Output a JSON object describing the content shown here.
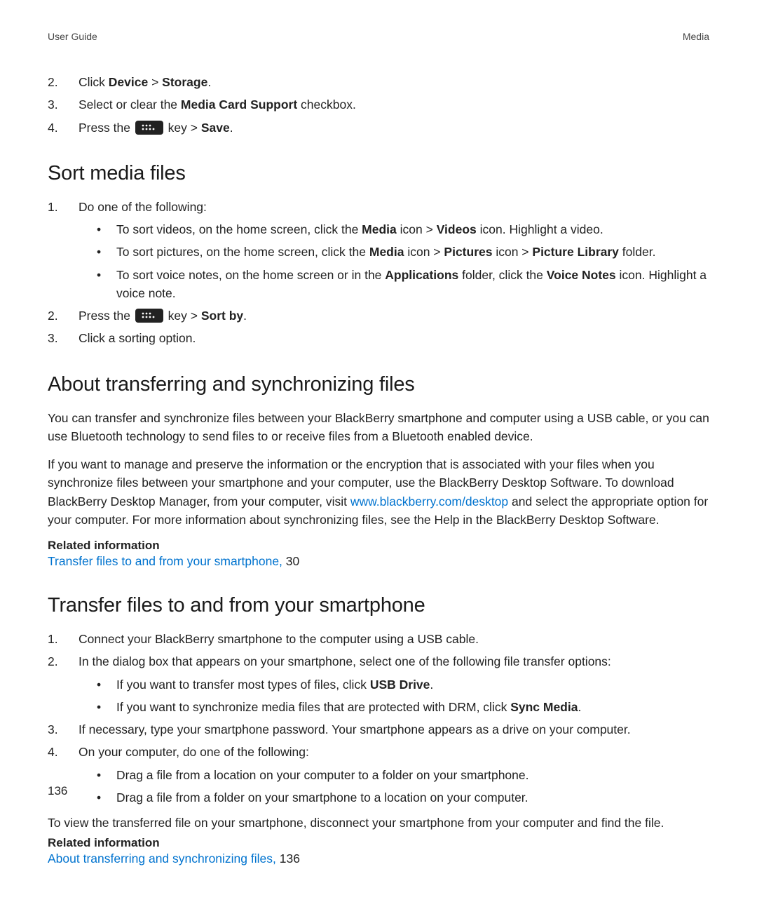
{
  "header": {
    "left": "User Guide",
    "right": "Media"
  },
  "page_number": "136",
  "intro_list": {
    "start": 1,
    "items": [
      {
        "pre": "Click ",
        "b1": "Device",
        "mid": " > ",
        "b2": "Storage",
        "post": "."
      },
      {
        "pre": "Select or clear the ",
        "b1": "Media Card Support",
        "mid": "",
        "b2": "",
        "post": " checkbox."
      },
      {
        "pre": "Press the  ",
        "key": true,
        "mid": "  key > ",
        "b1": "Save",
        "post": "."
      }
    ]
  },
  "section1": {
    "heading": "Sort media files",
    "list": [
      {
        "text": "Do one of the following:",
        "sub": [
          {
            "pre": "To sort videos, on the home screen, click the ",
            "b1": "Media",
            "mid1": " icon > ",
            "b2": "Videos",
            "post": " icon. Highlight a video."
          },
          {
            "pre": "To sort pictures, on the home screen, click the ",
            "b1": "Media",
            "mid1": " icon > ",
            "b2": "Pictures",
            "mid2": " icon > ",
            "b3": "Picture Library",
            "post": " folder."
          },
          {
            "pre": "To sort voice notes, on the home screen or in the ",
            "b1": "Applications",
            "mid1": " folder, click the ",
            "b2": "Voice Notes",
            "post": " icon. Highlight a voice note."
          }
        ]
      },
      {
        "pre": "Press the  ",
        "key": true,
        "mid": "  key > ",
        "b1": "Sort by",
        "post": "."
      },
      {
        "text": "Click a sorting option."
      }
    ]
  },
  "section2": {
    "heading": "About transferring and synchronizing files",
    "p1": "You can transfer and synchronize files between your BlackBerry smartphone and computer using a USB cable, or you can use Bluetooth technology to send files to or receive files from a Bluetooth enabled device.",
    "p2_pre": "If you want to manage and preserve the information or the encryption that is associated with your files when you synchronize files between your smartphone and your computer, use the BlackBerry Desktop Software. To download BlackBerry Desktop Manager, from your computer, visit ",
    "p2_link": "www.blackberry.com/desktop",
    "p2_post": " and select the appropriate option for your computer. For more information about synchronizing files, see the Help in the BlackBerry Desktop Software.",
    "related_heading": "Related information",
    "related_link": "Transfer files to and from your smartphone, ",
    "related_page": "30"
  },
  "section3": {
    "heading": "Transfer files to and from your smartphone",
    "list": [
      {
        "text": "Connect your BlackBerry smartphone to the computer using a USB cable."
      },
      {
        "text": "In the dialog box that appears on your smartphone, select one of the following file transfer options:",
        "sub": [
          {
            "pre": "If you want to transfer most types of files, click ",
            "b1": "USB Drive",
            "post": "."
          },
          {
            "pre": "If you want to synchronize media files that are protected with DRM, click ",
            "b1": "Sync Media",
            "post": "."
          }
        ]
      },
      {
        "text": "If necessary, type your smartphone password. Your smartphone appears as a drive on your computer."
      },
      {
        "text": "On your computer, do one of the following:",
        "sub": [
          {
            "text": "Drag a file from a location on your computer to a folder on your smartphone."
          },
          {
            "text": "Drag a file from a folder on your smartphone to a location on your computer."
          }
        ]
      }
    ],
    "p_after": "To view the transferred file on your smartphone, disconnect your smartphone from your computer and find the file.",
    "related_heading": "Related information",
    "related_link": "About transferring and synchronizing files, ",
    "related_page": "136"
  }
}
